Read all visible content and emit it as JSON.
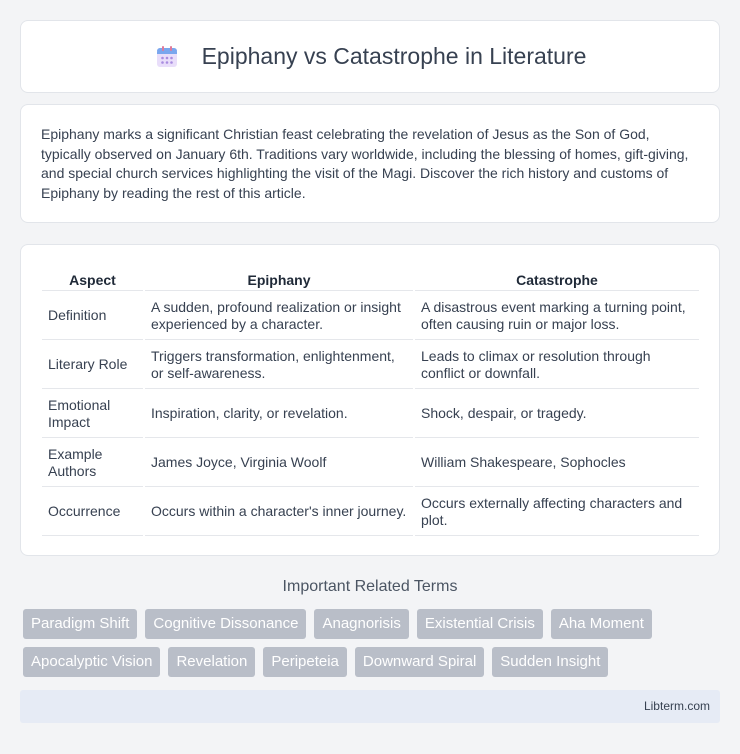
{
  "header": {
    "title": "Epiphany vs Catastrophe in Literature",
    "icon": "calendar-icon"
  },
  "intro": {
    "text": "Epiphany marks a significant Christian feast celebrating the revelation of Jesus as the Son of God, typically observed on January 6th. Traditions vary worldwide, including the blessing of homes, gift-giving, and special church services highlighting the visit of the Magi. Discover the rich history and customs of Epiphany by reading the rest of this article."
  },
  "table": {
    "headers": [
      "Aspect",
      "Epiphany",
      "Catastrophe"
    ],
    "rows": [
      [
        "Definition",
        "A sudden, profound realization or insight experienced by a character.",
        "A disastrous event marking a turning point, often causing ruin or major loss."
      ],
      [
        "Literary Role",
        "Triggers transformation, enlightenment, or self-awareness.",
        "Leads to climax or resolution through conflict or downfall."
      ],
      [
        "Emotional Impact",
        "Inspiration, clarity, or revelation.",
        "Shock, despair, or tragedy."
      ],
      [
        "Example Authors",
        "James Joyce, Virginia Woolf",
        "William Shakespeare, Sophocles"
      ],
      [
        "Occurrence",
        "Occurs within a character's inner journey.",
        "Occurs externally affecting characters and plot."
      ]
    ]
  },
  "related": {
    "title": "Important Related Terms",
    "tags": [
      "Paradigm Shift",
      "Cognitive Dissonance",
      "Anagnorisis",
      "Existential Crisis",
      "Aha Moment",
      "Apocalyptic Vision",
      "Revelation",
      "Peripeteia",
      "Downward Spiral",
      "Sudden Insight"
    ]
  },
  "footer": {
    "site": "Libterm.com"
  },
  "colors": {
    "tag_bg": "#b9bec8",
    "footer_bg": "#e6ebf5",
    "page_bg": "#f3f4f6"
  }
}
